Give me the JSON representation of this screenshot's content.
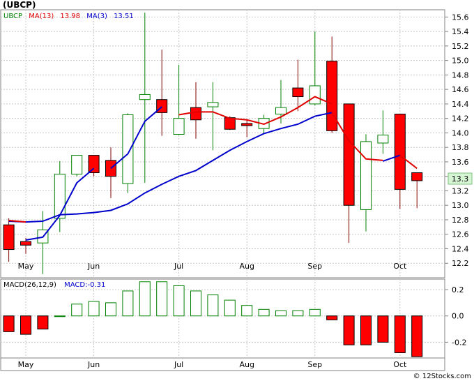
{
  "chart_data": {
    "type": "candlestick",
    "title": "(UBCP)",
    "price_panel": {
      "symbol": "UBCP",
      "ma13_label": "MA(13)",
      "ma13_value": "13.98",
      "ma3_label": "MA(3)",
      "ma3_value": "13.51",
      "last_price": "13.3",
      "y_ticks": [
        "12.2",
        "12.4",
        "12.6",
        "12.8",
        "13.0",
        "13.2",
        "13.4",
        "13.6",
        "13.8",
        "14.0",
        "14.2",
        "14.4",
        "14.6",
        "14.8",
        "15.0",
        "15.2",
        "15.4",
        "15.6"
      ],
      "ylim": [
        12.0,
        15.7
      ],
      "grid": true,
      "candles": [
        {
          "open": 12.39,
          "high": 12.82,
          "low": 12.22,
          "close": 12.73,
          "up": false
        },
        {
          "open": 12.5,
          "high": 12.55,
          "low": 12.33,
          "close": 12.45,
          "up": false
        },
        {
          "open": 12.48,
          "high": 12.92,
          "low": 12.05,
          "close": 12.66,
          "up": true
        },
        {
          "open": 12.82,
          "high": 13.61,
          "low": 12.63,
          "close": 13.43,
          "up": true
        },
        {
          "open": 13.43,
          "high": 13.69,
          "low": 13.4,
          "close": 13.69,
          "up": true
        },
        {
          "open": 13.69,
          "high": 13.69,
          "low": 13.4,
          "close": 13.45,
          "up": false
        },
        {
          "open": 13.62,
          "high": 13.8,
          "low": 13.1,
          "close": 13.4,
          "up": false
        },
        {
          "open": 13.3,
          "high": 14.27,
          "low": 13.17,
          "close": 14.25,
          "up": true
        },
        {
          "open": 14.46,
          "high": 15.66,
          "low": 13.31,
          "close": 14.53,
          "up": true
        },
        {
          "open": 14.46,
          "high": 15.15,
          "low": 13.96,
          "close": 14.28,
          "up": false
        },
        {
          "open": 13.98,
          "high": 14.94,
          "low": 13.97,
          "close": 14.2,
          "up": true
        },
        {
          "open": 14.35,
          "high": 14.7,
          "low": 13.92,
          "close": 14.18,
          "up": false
        },
        {
          "open": 14.36,
          "high": 14.7,
          "low": 13.76,
          "close": 14.42,
          "up": true
        },
        {
          "open": 14.21,
          "high": 14.23,
          "low": 14.04,
          "close": 14.05,
          "up": false
        },
        {
          "open": 14.13,
          "high": 14.18,
          "low": 13.94,
          "close": 14.1,
          "up": false
        },
        {
          "open": 14.06,
          "high": 14.25,
          "low": 14.0,
          "close": 14.2,
          "up": true
        },
        {
          "open": 14.26,
          "high": 14.73,
          "low": 14.13,
          "close": 14.35,
          "up": true
        },
        {
          "open": 14.62,
          "high": 15.01,
          "low": 14.3,
          "close": 14.5,
          "up": false
        },
        {
          "open": 14.4,
          "high": 15.4,
          "low": 14.38,
          "close": 14.65,
          "up": true
        },
        {
          "open": 14.99,
          "high": 15.33,
          "low": 14.0,
          "close": 14.03,
          "up": false
        },
        {
          "open": 14.4,
          "high": 14.4,
          "low": 12.48,
          "close": 13.0,
          "up": false
        },
        {
          "open": 12.94,
          "high": 13.98,
          "low": 12.64,
          "close": 13.88,
          "up": true
        },
        {
          "open": 13.86,
          "high": 14.31,
          "low": 13.71,
          "close": 13.97,
          "up": true
        },
        {
          "open": 14.26,
          "high": 14.26,
          "low": 12.95,
          "close": 13.22,
          "up": false
        },
        {
          "open": 13.45,
          "high": 13.45,
          "low": 12.96,
          "close": 13.34,
          "up": false
        }
      ],
      "ma13_series": [
        12.78,
        12.77,
        12.78,
        12.87,
        12.88,
        12.9,
        12.93,
        13.02,
        13.17,
        13.29,
        13.4,
        13.48,
        13.62,
        13.76,
        13.88,
        13.99,
        14.06,
        14.12,
        14.23,
        14.28,
        null,
        null,
        null,
        null,
        null
      ],
      "ma3_segments": [
        [
          [
            0,
            12.79
          ],
          [
            1,
            12.77
          ]
        ],
        [
          [
            1,
            12.52
          ],
          [
            2,
            12.56
          ],
          [
            3,
            12.86
          ],
          [
            4,
            13.31
          ],
          [
            5,
            13.51
          ]
        ],
        [
          [
            6,
            13.51
          ],
          [
            7,
            13.71
          ],
          [
            8,
            14.16
          ],
          [
            9,
            14.36
          ]
        ],
        [
          [
            10,
            14.25
          ],
          [
            11,
            14.29
          ],
          [
            12,
            14.29
          ],
          [
            13,
            14.2
          ],
          [
            14,
            14.18
          ],
          [
            15,
            14.12
          ],
          [
            16,
            14.22
          ],
          [
            17,
            14.35
          ],
          [
            18,
            14.5
          ],
          [
            19,
            14.4
          ]
        ],
        [
          [
            19,
            14.28
          ],
          [
            20,
            13.89
          ],
          [
            21,
            13.64
          ],
          [
            22,
            13.62
          ]
        ],
        [
          [
            22,
            13.61
          ],
          [
            23,
            13.69
          ]
        ],
        [
          [
            23,
            13.69
          ],
          [
            24,
            13.51
          ]
        ]
      ],
      "ma3_red_tail": [
        [
          19,
          14.28
        ],
        [
          20,
          13.89
        ],
        [
          21,
          13.64
        ],
        [
          22,
          13.62
        ]
      ]
    },
    "macd_panel": {
      "label": "MACD(26,12,9)",
      "value_label": "MACD:-0.31",
      "y_ticks": [
        "0.2",
        "0.0",
        "-0.2"
      ],
      "ylim": [
        -0.32,
        0.28
      ],
      "values": [
        -0.12,
        -0.14,
        -0.1,
        0.0,
        0.09,
        0.11,
        0.1,
        0.19,
        0.26,
        0.26,
        0.23,
        0.19,
        0.16,
        0.12,
        0.08,
        0.05,
        0.04,
        0.04,
        0.05,
        -0.03,
        -0.22,
        -0.22,
        -0.2,
        -0.28,
        -0.31
      ]
    },
    "x_labels": [
      "May",
      "Jun",
      "Jul",
      "Aug",
      "Sep",
      "Oct"
    ],
    "x_label_index": [
      1,
      5,
      10,
      14,
      18,
      23
    ],
    "watermark": "© 12Stocks.com"
  }
}
